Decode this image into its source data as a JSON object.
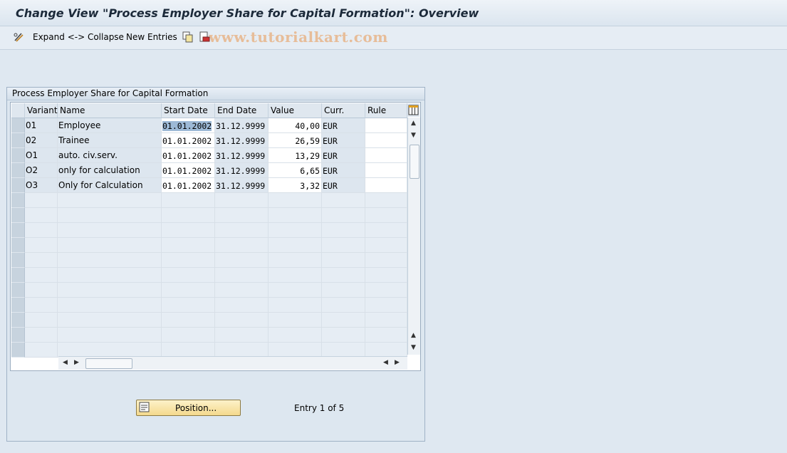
{
  "window": {
    "title": "Change View \"Process Employer Share for Capital Formation\": Overview"
  },
  "toolbar": {
    "expand_collapse": "Expand <-> Collapse",
    "new_entries": "New Entries",
    "watermark": "www.tutorialkart.com"
  },
  "panel": {
    "title": "Process Employer Share for Capital Formation"
  },
  "table": {
    "columns": [
      "Variant",
      "Name",
      "Start Date",
      "End Date",
      "Value",
      "Curr.",
      "Rule"
    ],
    "rows": [
      {
        "variant": "01",
        "name": "Employee",
        "start": "01.01.2002",
        "end": "31.12.9999",
        "value": "40,00",
        "curr": "EUR",
        "rule": ""
      },
      {
        "variant": "02",
        "name": "Trainee",
        "start": "01.01.2002",
        "end": "31.12.9999",
        "value": "26,59",
        "curr": "EUR",
        "rule": ""
      },
      {
        "variant": "O1",
        "name": "auto. civ.serv.",
        "start": "01.01.2002",
        "end": "31.12.9999",
        "value": "13,29",
        "curr": "EUR",
        "rule": ""
      },
      {
        "variant": "O2",
        "name": "only for calculation",
        "start": "01.01.2002",
        "end": "31.12.9999",
        "value": "6,65",
        "curr": "EUR",
        "rule": ""
      },
      {
        "variant": "O3",
        "name": "Only for Calculation",
        "start": "01.01.2002",
        "end": "31.12.9999",
        "value": "3,32",
        "curr": "EUR",
        "rule": ""
      }
    ]
  },
  "footer": {
    "position_label": "Position...",
    "entry_info": "Entry 1 of 5"
  },
  "icons": {
    "expand": "pencil-glasses-icon",
    "copy": "copy-icon",
    "delete": "delete-icon",
    "settings": "table-settings-icon",
    "position": "position-icon"
  },
  "colors": {
    "background": "#dfe8f1",
    "readonly_cell": "#dde6ef",
    "selection": "#9db9d6",
    "button": "#f4d98d"
  }
}
